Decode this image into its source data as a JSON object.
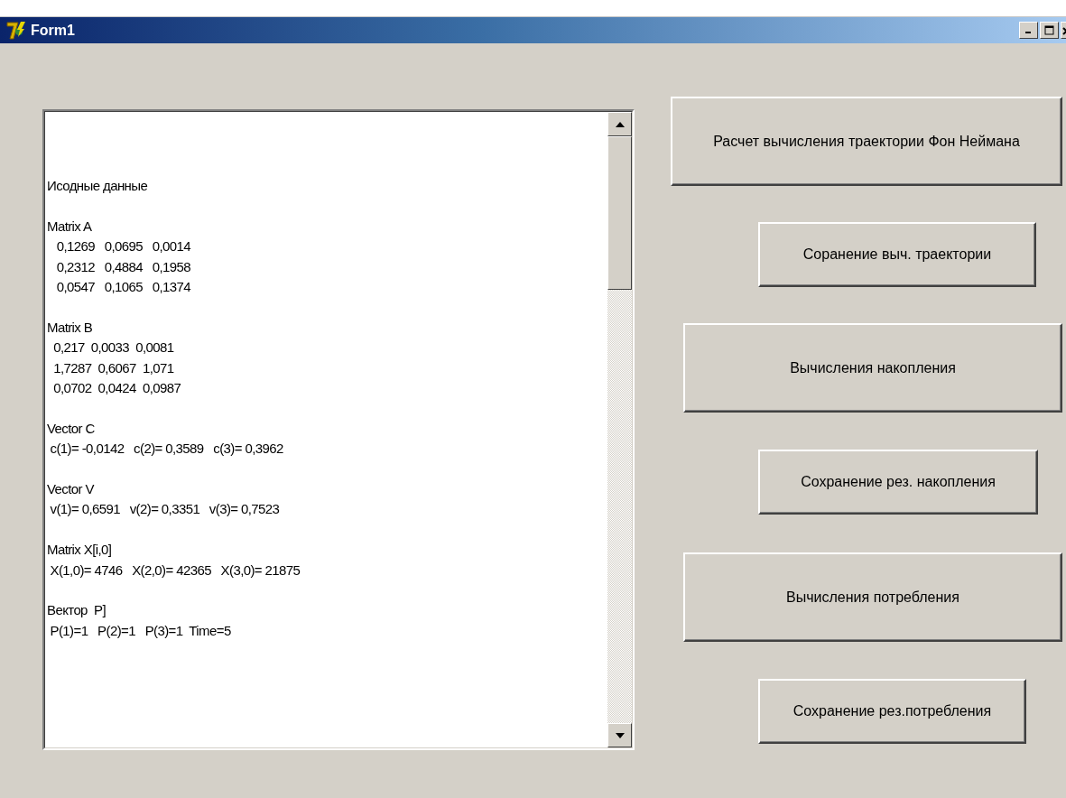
{
  "window": {
    "title": "Form1"
  },
  "memo": {
    "blocks": [
      {
        "lines": [
          "Исодные данные"
        ]
      },
      {
        "lines": [
          "Matrix A",
          "   0,1269   0,0695   0,0014",
          "   0,2312   0,4884   0,1958",
          "   0,0547   0,1065   0,1374"
        ]
      },
      {
        "lines": [
          "Matrix B",
          "  0,217  0,0033  0,0081",
          "  1,7287  0,6067  1,071",
          "  0,0702  0,0424  0,0987"
        ]
      },
      {
        "lines": [
          "Vector C",
          " c(1)= -0,0142   c(2)= 0,3589   c(3)= 0,3962"
        ]
      },
      {
        "lines": [
          "Vector V",
          " v(1)= 0,6591   v(2)= 0,3351   v(3)= 0,7523"
        ]
      },
      {
        "lines": [
          "Matrix X[i,0]",
          " X(1,0)= 4746   X(2,0)= 42365   X(3,0)= 21875"
        ]
      },
      {
        "lines": [
          "Вектор  P]",
          " P(1)=1   P(2)=1   P(3)=1  Time=5"
        ]
      }
    ]
  },
  "buttons": [
    {
      "label": "Расчет вычисления  траектории Фон Неймана",
      "kind": "wide"
    },
    {
      "label": "Соранение выч. траектории",
      "kind": "narrow"
    },
    {
      "label": "Вычисления накопления",
      "kind": "wide"
    },
    {
      "label": "Сохранение  рез. накопления",
      "kind": "narrow"
    },
    {
      "label": "Вычисления потребления",
      "kind": "wide"
    },
    {
      "label": "Сохранение рез.потребления",
      "kind": "narrow"
    }
  ]
}
